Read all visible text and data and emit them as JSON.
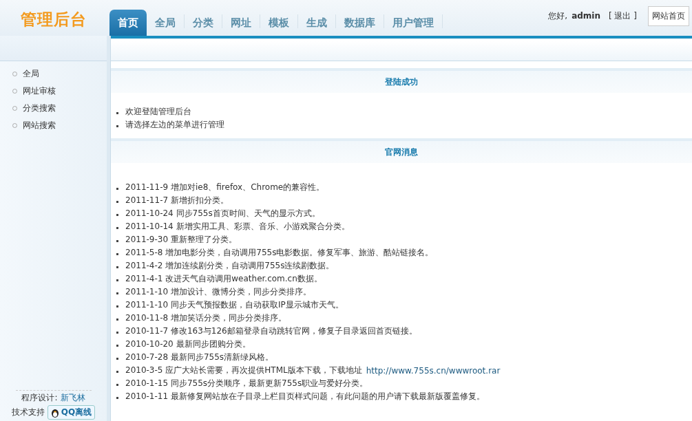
{
  "logo": "管理后台",
  "tabs": [
    {
      "label": "首页",
      "selected": true
    },
    {
      "label": "全局",
      "selected": false
    },
    {
      "label": "分类",
      "selected": false
    },
    {
      "label": "网址",
      "selected": false
    },
    {
      "label": "模板",
      "selected": false
    },
    {
      "label": "生成",
      "selected": false
    },
    {
      "label": "数据库",
      "selected": false
    },
    {
      "label": "用户管理",
      "selected": false
    }
  ],
  "user": {
    "greeting": "您好,",
    "name": "admin",
    "logout": "[ 退出 ]",
    "home_button": "网站首页"
  },
  "sidebar": {
    "items": [
      "全局",
      "网址审核",
      "分类搜索",
      "网站搜索"
    ],
    "credit_label": "程序设计:",
    "credit_link": "新飞林",
    "support_label": "技术支持",
    "qq_status": "QQ离线"
  },
  "sections": [
    {
      "title": "登陆成功",
      "items": [
        {
          "text": "欢迎登陆管理后台"
        },
        {
          "text": "请选择左边的菜单进行管理"
        }
      ]
    },
    {
      "title": "官网消息",
      "items": [
        {
          "text": "2011-11-9 增加对ie8、firefox、Chrome的兼容性。"
        },
        {
          "text": "2011-11-7 新增折扣分类。"
        },
        {
          "text": "2011-10-24 同步755s首页时间、天气的显示方式。"
        },
        {
          "text": "2011-10-14 新增实用工具、彩票、音乐、小游戏聚合分类。"
        },
        {
          "text": "2011-9-30 重新整理了分类。"
        },
        {
          "text": "2011-5-8 增加电影分类，自动调用755s电影数据。修复军事、旅游、酷站链接名。"
        },
        {
          "text": "2011-4-2 增加连续剧分类，自动调用755s连续剧数据。"
        },
        {
          "text": "2011-4-1 改进天气自动调用weather.com.cn数据。"
        },
        {
          "text": "2011-1-10 增加设计、微博分类，同步分类排序。"
        },
        {
          "text": "2011-1-10 同步天气预报数据，自动获取IP显示城市天气。"
        },
        {
          "text": "2010-11-8 增加笑话分类，同步分类排序。"
        },
        {
          "text": "2010-11-7 修改163与126邮箱登录自动跳转官网，修复子目录返回首页链接。"
        },
        {
          "text": "2010-10-20 最新同步团购分类。"
        },
        {
          "text": "2010-7-28 最新同步755s清新绿风格。"
        },
        {
          "text": "2010-3-5 应广大站长需要，再次提供HTML版本下载，下载地址",
          "link": "http://www.755s.cn/wwwroot.rar"
        },
        {
          "text": "2010-1-15 同步755s分类顺序，最新更新755s职业与爱好分类。"
        },
        {
          "text": "2010-1-11 最新修复网站放在子目录上栏目页样式问题，有此问题的用户请下载最新版覆盖修复。"
        }
      ]
    }
  ]
}
